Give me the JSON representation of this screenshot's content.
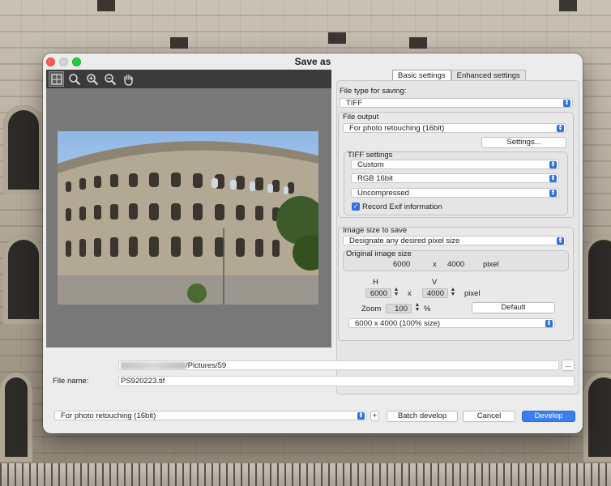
{
  "window": {
    "title": "Save as"
  },
  "preview_toolbar": {
    "tools": [
      "fit-icon",
      "zoom-icon",
      "zoom-in-icon",
      "zoom-out-icon",
      "hand-icon"
    ]
  },
  "tabs": [
    {
      "label": "Basic settings",
      "active": true
    },
    {
      "label": "Enhanced settings",
      "active": false
    }
  ],
  "file_type": {
    "label": "File type for saving:",
    "value": "TIFF"
  },
  "file_output": {
    "label": "File output",
    "value": "For photo retouching (16bit)",
    "settings_button": "Settings..."
  },
  "tiff_settings": {
    "label": "TIFF settings",
    "preset": "Custom",
    "color": "RGB 16bit",
    "compression": "Uncompressed",
    "exif_label": "Record Exif information",
    "exif_checked": true
  },
  "image_size": {
    "label": "Image size to save",
    "mode": "Designate any desired pixel size",
    "original_label": "Original image size",
    "original_w": "6000",
    "times": "x",
    "original_h": "4000",
    "pixel_unit": "pixel",
    "h_label": "H",
    "v_label": "V",
    "h_value": "6000",
    "v_value": "4000",
    "pixel_unit2": "pixel",
    "zoom_label": "Zoom",
    "zoom_value": "100",
    "percent": "%",
    "default_button": "Default",
    "preset": "6000 x  4000  (100% size)"
  },
  "output_path": {
    "value": "/Pictures/59",
    "browse_label": "..."
  },
  "file_name": {
    "label": "File name:",
    "value": "PS920223.tif"
  },
  "bottom": {
    "preset": "For photo retouching (16bit)",
    "add_label": "+",
    "batch_button": "Batch develop",
    "cancel_button": "Cancel",
    "develop_button": "Develop"
  },
  "colors": {
    "accent": "#3a7ef2",
    "toolbar": "#3b3b3b",
    "preview_bg": "#787878"
  }
}
